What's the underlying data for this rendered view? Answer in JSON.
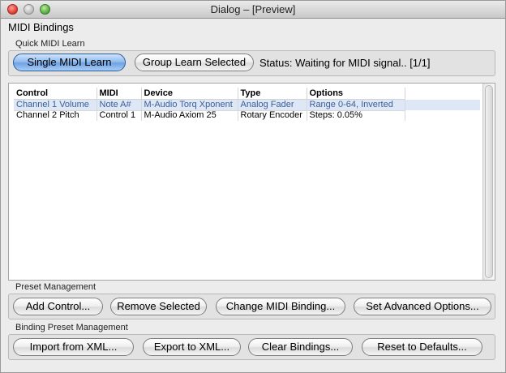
{
  "window": {
    "title": "Dialog – [Preview]"
  },
  "heading": "MIDI Bindings",
  "quick_learn": {
    "label": "Quick MIDI Learn",
    "single_button": "Single MIDI Learn",
    "group_button": "Group Learn Selected",
    "status": "Status: Waiting for MIDI signal.. [1/1]"
  },
  "table": {
    "columns": [
      "Control",
      "MIDI",
      "Device",
      "Type",
      "Options"
    ],
    "rows": [
      {
        "control": "Channel 1 Volume",
        "midi": "Note A#",
        "device": "M-Audio Torq Xponent",
        "type": "Analog Fader",
        "options": "Range 0-64, Inverted"
      },
      {
        "control": "Channel 2 Pitch",
        "midi": "Control 1",
        "device": "M-Audio Axiom 25",
        "type": "Rotary Encoder",
        "options": "Steps: 0.05%"
      }
    ]
  },
  "preset_management": {
    "label": "Preset Management",
    "add": "Add Control...",
    "remove": "Remove Selected",
    "change": "Change MIDI Binding...",
    "advanced": "Set Advanced Options..."
  },
  "binding_preset_management": {
    "label": "Binding Preset Management",
    "import": "Import from XML...",
    "export": "Export to XML...",
    "clear": "Clear Bindings...",
    "reset": "Reset to Defaults..."
  }
}
